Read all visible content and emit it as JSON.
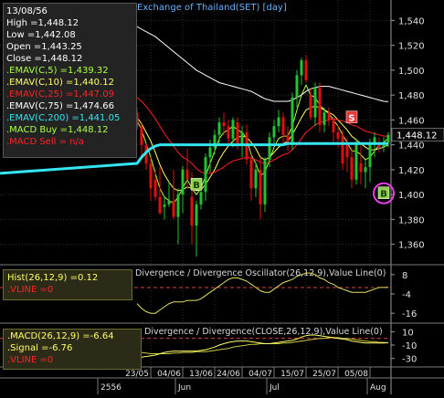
{
  "chart_data": {
    "type": "candlestick",
    "title": "Exchange of Thailand(SET) [day]",
    "price_axis": {
      "ticks": [
        1360,
        1380,
        1400,
        1420,
        1440,
        1460,
        1480,
        1500,
        1520,
        1540
      ],
      "labels": [
        "1,360",
        "1,380",
        "1,400",
        "1,420",
        "1,440",
        "1,460",
        "1,480",
        "1,500",
        "1,520",
        "1,540"
      ],
      "range": [
        1345,
        1555
      ]
    },
    "last_price_label": "1,448.12",
    "last_price": 1448.12,
    "candles": [
      {
        "o": 1466,
        "h": 1470,
        "l": 1452,
        "c": 1455
      },
      {
        "o": 1455,
        "h": 1457,
        "l": 1430,
        "c": 1440
      },
      {
        "o": 1440,
        "h": 1441,
        "l": 1420,
        "c": 1425
      },
      {
        "o": 1425,
        "h": 1430,
        "l": 1395,
        "c": 1405
      },
      {
        "o": 1412,
        "h": 1420,
        "l": 1395,
        "c": 1398
      },
      {
        "o": 1398,
        "h": 1422,
        "l": 1384,
        "c": 1385
      },
      {
        "o": 1390,
        "h": 1398,
        "l": 1380,
        "c": 1392
      },
      {
        "o": 1392,
        "h": 1410,
        "l": 1390,
        "c": 1395
      },
      {
        "o": 1395,
        "h": 1420,
        "l": 1380,
        "c": 1382
      },
      {
        "o": 1382,
        "h": 1405,
        "l": 1360,
        "c": 1400
      },
      {
        "o": 1400,
        "h": 1423,
        "l": 1385,
        "c": 1420
      },
      {
        "o": 1420,
        "h": 1437,
        "l": 1405,
        "c": 1412
      },
      {
        "o": 1398,
        "h": 1418,
        "l": 1360,
        "c": 1375
      },
      {
        "o": 1375,
        "h": 1395,
        "l": 1350,
        "c": 1392
      },
      {
        "o": 1392,
        "h": 1412,
        "l": 1388,
        "c": 1402
      },
      {
        "o": 1402,
        "h": 1433,
        "l": 1395,
        "c": 1430
      },
      {
        "o": 1430,
        "h": 1444,
        "l": 1418,
        "c": 1438
      },
      {
        "o": 1438,
        "h": 1452,
        "l": 1432,
        "c": 1448
      },
      {
        "o": 1448,
        "h": 1462,
        "l": 1440,
        "c": 1458
      },
      {
        "o": 1458,
        "h": 1466,
        "l": 1448,
        "c": 1455
      },
      {
        "o": 1455,
        "h": 1460,
        "l": 1440,
        "c": 1445
      },
      {
        "o": 1445,
        "h": 1462,
        "l": 1438,
        "c": 1460
      },
      {
        "o": 1458,
        "h": 1462,
        "l": 1436,
        "c": 1440
      },
      {
        "o": 1440,
        "h": 1455,
        "l": 1430,
        "c": 1450
      },
      {
        "o": 1450,
        "h": 1456,
        "l": 1424,
        "c": 1428
      },
      {
        "o": 1428,
        "h": 1432,
        "l": 1395,
        "c": 1405
      },
      {
        "o": 1405,
        "h": 1426,
        "l": 1398,
        "c": 1420
      },
      {
        "o": 1420,
        "h": 1430,
        "l": 1380,
        "c": 1392
      },
      {
        "o": 1392,
        "h": 1430,
        "l": 1386,
        "c": 1428
      },
      {
        "o": 1428,
        "h": 1450,
        "l": 1422,
        "c": 1446
      },
      {
        "o": 1446,
        "h": 1460,
        "l": 1440,
        "c": 1455
      },
      {
        "o": 1455,
        "h": 1468,
        "l": 1450,
        "c": 1462
      },
      {
        "o": 1462,
        "h": 1466,
        "l": 1440,
        "c": 1448
      },
      {
        "o": 1448,
        "h": 1455,
        "l": 1435,
        "c": 1440
      },
      {
        "o": 1440,
        "h": 1482,
        "l": 1436,
        "c": 1478
      },
      {
        "o": 1478,
        "h": 1500,
        "l": 1470,
        "c": 1496
      },
      {
        "o": 1496,
        "h": 1510,
        "l": 1488,
        "c": 1508
      },
      {
        "o": 1508,
        "h": 1512,
        "l": 1490,
        "c": 1492
      },
      {
        "o": 1480,
        "h": 1485,
        "l": 1460,
        "c": 1462
      },
      {
        "o": 1462,
        "h": 1490,
        "l": 1455,
        "c": 1486
      },
      {
        "o": 1486,
        "h": 1490,
        "l": 1450,
        "c": 1456
      },
      {
        "o": 1456,
        "h": 1470,
        "l": 1450,
        "c": 1466
      },
      {
        "o": 1466,
        "h": 1470,
        "l": 1455,
        "c": 1460
      },
      {
        "o": 1460,
        "h": 1462,
        "l": 1442,
        "c": 1450
      },
      {
        "o": 1450,
        "h": 1456,
        "l": 1438,
        "c": 1445
      },
      {
        "o": 1448,
        "h": 1452,
        "l": 1420,
        "c": 1425
      },
      {
        "o": 1440,
        "h": 1445,
        "l": 1418,
        "c": 1430
      },
      {
        "o": 1430,
        "h": 1438,
        "l": 1405,
        "c": 1412
      },
      {
        "o": 1412,
        "h": 1445,
        "l": 1408,
        "c": 1440
      },
      {
        "o": 1425,
        "h": 1442,
        "l": 1408,
        "c": 1418
      },
      {
        "o": 1418,
        "h": 1428,
        "l": 1405,
        "c": 1422
      },
      {
        "o": 1422,
        "h": 1445,
        "l": 1410,
        "c": 1440
      },
      {
        "o": 1440,
        "h": 1450,
        "l": 1430,
        "c": 1446
      },
      {
        "o": 1442,
        "h": 1446,
        "l": 1434,
        "c": 1438
      },
      {
        "o": 1438,
        "h": 1446,
        "l": 1434,
        "c": 1442
      },
      {
        "o": 1442,
        "h": 1450,
        "l": 1438,
        "c": 1448
      }
    ],
    "series": [
      {
        "name": "EMAV(C,5)",
        "color": "#aaff44",
        "values": [
          1460,
          1452,
          1441,
          1430,
          1417,
          1405,
          1398,
          1395,
          1393,
          1398,
          1405,
          1412,
          1405,
          1400,
          1405,
          1415,
          1425,
          1435,
          1445,
          1450,
          1452,
          1455,
          1452,
          1450,
          1445,
          1432,
          1425,
          1415,
          1418,
          1428,
          1438,
          1445,
          1447,
          1447,
          1455,
          1468,
          1480,
          1488,
          1480,
          1478,
          1472,
          1468,
          1465,
          1460,
          1455,
          1448,
          1442,
          1435,
          1435,
          1432,
          1428,
          1430,
          1435,
          1440,
          1442,
          1445
        ]
      },
      {
        "name": "EMAV(C,10)",
        "color": "#ffff66",
        "values": [
          1462,
          1457,
          1450,
          1443,
          1434,
          1424,
          1416,
          1410,
          1405,
          1403,
          1404,
          1406,
          1405,
          1403,
          1404,
          1408,
          1414,
          1420,
          1428,
          1434,
          1439,
          1443,
          1446,
          1447,
          1446,
          1442,
          1437,
          1430,
          1428,
          1430,
          1434,
          1438,
          1441,
          1443,
          1448,
          1455,
          1462,
          1468,
          1470,
          1471,
          1470,
          1468,
          1466,
          1464,
          1460,
          1456,
          1452,
          1447,
          1444,
          1441,
          1438,
          1436,
          1436,
          1437,
          1438,
          1440
        ]
      },
      {
        "name": "EMAV(C,25)",
        "color": "#ff2222",
        "values": [
          1478,
          1475,
          1471,
          1466,
          1461,
          1455,
          1449,
          1444,
          1439,
          1434,
          1430,
          1428,
          1425,
          1421,
          1418,
          1417,
          1417,
          1418,
          1420,
          1422,
          1425,
          1427,
          1428,
          1429,
          1430,
          1429,
          1428,
          1426,
          1425,
          1426,
          1428,
          1430,
          1432,
          1433,
          1436,
          1440,
          1445,
          1450,
          1453,
          1456,
          1458,
          1459,
          1460,
          1461,
          1460,
          1459,
          1458,
          1456,
          1455,
          1453,
          1451,
          1450,
          1449,
          1448,
          1447,
          1447
        ]
      },
      {
        "name": "EMAV(C,75)",
        "color": "#ffffff",
        "values": [
          1535,
          1533,
          1531,
          1529,
          1527,
          1524,
          1521,
          1518,
          1515,
          1512,
          1509,
          1506,
          1503,
          1500,
          1498,
          1496,
          1494,
          1492,
          1490,
          1489,
          1488,
          1487,
          1486,
          1485,
          1484,
          1483,
          1481,
          1479,
          1477,
          1476,
          1475,
          1475,
          1475,
          1475,
          1476,
          1478,
          1480,
          1483,
          1485,
          1486,
          1487,
          1487,
          1487,
          1486,
          1485,
          1484,
          1483,
          1482,
          1481,
          1480,
          1479,
          1478,
          1477,
          1476,
          1475,
          1474.66
        ]
      },
      {
        "name": "EMAV(C,200)",
        "color": "#33e6f0",
        "values": [
          1425,
          1430,
          1434,
          1437,
          1439,
          1440,
          1440,
          1440,
          1440,
          1440,
          1440,
          1440,
          1440,
          1440,
          1440,
          1440,
          1440,
          1440,
          1440,
          1440,
          1440,
          1440,
          1440,
          1440,
          1440,
          1440,
          1440,
          1440,
          1440,
          1440,
          1440,
          1440,
          1440,
          1441,
          1441,
          1441,
          1441,
          1441,
          1441,
          1441,
          1441,
          1441,
          1441,
          1441,
          1441,
          1441,
          1441,
          1441,
          1441,
          1441,
          1441,
          1441,
          1441,
          1441,
          1441,
          1441.05
        ]
      }
    ],
    "signals": [
      {
        "label": "B",
        "index": 13,
        "price": 1408,
        "color": "#8fd14f"
      },
      {
        "label": "S",
        "index": 47,
        "price": 1462,
        "color": "#e53935"
      },
      {
        "label": "B",
        "index": 54,
        "price": 1401,
        "color": "#8fd14f"
      }
    ],
    "x_ticks": [
      {
        "label": "23/05",
        "index": 3
      },
      {
        "label": "04/06",
        "index": 10
      },
      {
        "label": "13/06",
        "index": 17
      },
      {
        "label": "24/06",
        "index": 23
      },
      {
        "label": "04/07",
        "index": 30
      },
      {
        "label": "15/07",
        "index": 37
      },
      {
        "label": "25/07",
        "index": 44
      },
      {
        "label": "05/08",
        "index": 51
      }
    ],
    "months": [
      {
        "label": "2556",
        "index": -8
      },
      {
        "label": "Jun",
        "index": 9
      },
      {
        "label": "Jul",
        "index": 29
      },
      {
        "label": "Aug",
        "index": 51
      }
    ],
    "divergence_osc": {
      "title": "Divergence / Divergence Oscillator(26,12,9),Value Line(0)",
      "ticks": [
        8,
        -4,
        -16
      ],
      "tick_labels": [
        "8",
        "-4",
        "-16"
      ],
      "range": [
        -21,
        13
      ],
      "value_line": 0,
      "values": [
        -10,
        -13,
        -15,
        -16,
        -16,
        -14,
        -12,
        -10,
        -9,
        -9,
        -9,
        -8,
        -8,
        -8,
        -7,
        -5,
        -3,
        -1,
        1,
        3,
        5,
        6,
        6,
        5,
        4,
        2,
        0,
        -2,
        -3,
        -3,
        -1,
        1,
        3,
        4,
        5,
        7,
        8,
        9,
        9,
        8,
        6,
        5,
        3,
        2,
        0,
        -1,
        -2,
        -3,
        -3,
        -3,
        -3,
        -2,
        -1,
        0,
        0,
        0.12
      ]
    },
    "macd": {
      "title": "Divergence / Divergence(CLOSE,26,12,9),Value Line(0)",
      "ticks": [
        10,
        -10,
        -30
      ],
      "tick_labels": [
        "10",
        "-10",
        "-30"
      ],
      "range": [
        -40,
        20
      ],
      "value_line": 0,
      "macd": [
        -28,
        -28,
        -27,
        -26,
        -25,
        -23,
        -21,
        -20,
        -19,
        -19,
        -19,
        -19,
        -19,
        -19,
        -18,
        -17,
        -15,
        -13,
        -10,
        -8,
        -6,
        -5,
        -4,
        -4,
        -4,
        -5,
        -6,
        -7,
        -8,
        -8,
        -7,
        -6,
        -5,
        -4,
        -3,
        -1,
        2,
        4,
        5,
        5,
        4,
        3,
        2,
        1,
        0,
        -1,
        -2,
        -4,
        -5,
        -6,
        -7,
        -7,
        -7,
        -7,
        -7,
        -6.64
      ],
      "signal": [
        -20,
        -21,
        -22,
        -23,
        -23,
        -23,
        -23,
        -23,
        -22,
        -22,
        -21,
        -21,
        -21,
        -20,
        -20,
        -20,
        -19,
        -18,
        -17,
        -16,
        -15,
        -13,
        -12,
        -11,
        -10,
        -9,
        -9,
        -8,
        -8,
        -8,
        -8,
        -8,
        -7,
        -7,
        -6,
        -5,
        -4,
        -3,
        -2,
        -1,
        0,
        0,
        1,
        1,
        1,
        0,
        0,
        -1,
        -2,
        -3,
        -4,
        -5,
        -5,
        -6,
        -6,
        -6.76
      ]
    }
  },
  "info_main": {
    "date": "13/08/56",
    "high": "High  =1,448.12",
    "low": "Low  =1,442.08",
    "open": "Open  =1,443.25",
    "close": "Close  =1,448.12",
    "emav5": ".EMAV(C,5)  =1,439.32",
    "emav10": ".EMAV(C,10)  =1,440.12",
    "emav25": ".EMAV(C,25)  =1,447.09",
    "emav75": ".EMAV(C,75)  =1,474.66",
    "emav200": ".EMAV(C,200)  =1,441.05",
    "macd_buy": ".MACD Buy  =1,448.12",
    "macd_sell": ".MACD Sell  = n/a"
  },
  "info_hist": {
    "hist": "Hist(26,12,9)  =0.12",
    "vline": ".VLINE  =0"
  },
  "info_macd": {
    "macd": ".MACD(26,12,9)  =-6.64",
    "signal": ".Signal  =-6.76",
    "vline": ".VLINE  =0"
  },
  "colors": {
    "background": "#000000",
    "up": "#22c232",
    "down": "#e01010",
    "grid": "#2e2e2e"
  }
}
